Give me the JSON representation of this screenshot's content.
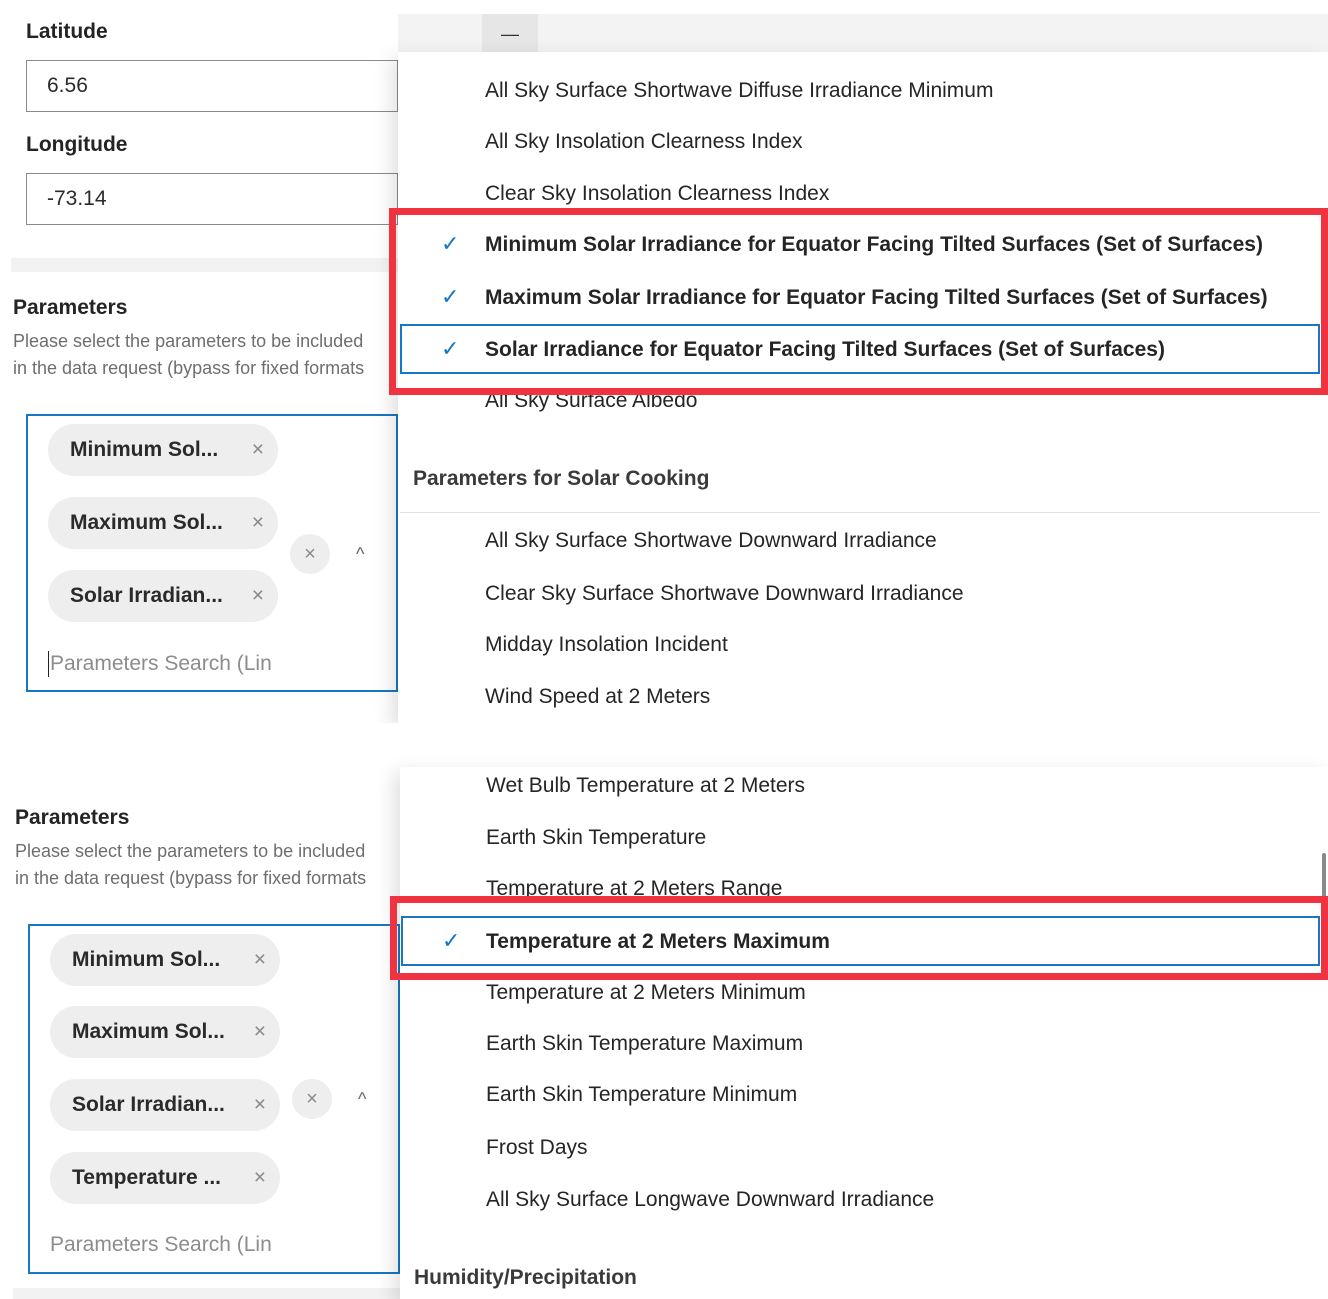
{
  "colors": {
    "accent": "#1677c4",
    "highlight": "#ef3340",
    "chip": "#eeeeee"
  },
  "top": {
    "latitude_label": "Latitude",
    "latitude_value": "6.56",
    "longitude_label": "Longitude",
    "longitude_value": "-73.14",
    "collapse_button": "—",
    "parameters_title": "Parameters",
    "parameters_desc_1": "Please select the parameters to be included",
    "parameters_desc_2": "in the data request (bypass for fixed formats",
    "chips": [
      "Minimum Sol...",
      "Maximum Sol...",
      "Solar Irradian..."
    ],
    "chip_remove": "×",
    "clear_all": "×",
    "caret": "^",
    "search_placeholder": "Parameters Search (Lin",
    "options_a": [
      "All Sky Surface Shortwave Diffuse Irradiance Minimum",
      "All Sky Insolation Clearness Index",
      "Clear Sky Insolation Clearness Index"
    ],
    "selected": [
      "Minimum Solar Irradiance for Equator Facing Tilted Surfaces (Set of Surfaces)",
      "Maximum Solar Irradiance for Equator Facing Tilted Surfaces (Set of Surfaces)",
      "Solar Irradiance for Equator Facing Tilted Surfaces (Set of Surfaces)"
    ],
    "check": "✓",
    "option_after": "All Sky Surface Albedo",
    "group_label": "Parameters for Solar Cooking",
    "options_b": [
      "All Sky Surface Shortwave Downward Irradiance",
      "Clear Sky Surface Shortwave Downward Irradiance",
      "Midday Insolation Incident",
      "Wind Speed at 2 Meters"
    ]
  },
  "bottom": {
    "parameters_title": "Parameters",
    "parameters_desc_1": "Please select the parameters to be included",
    "parameters_desc_2": "in the data request (bypass for fixed formats",
    "chips": [
      "Minimum Sol...",
      "Maximum Sol...",
      "Solar Irradian...",
      "Temperature ..."
    ],
    "chip_remove": "×",
    "clear_all": "×",
    "caret": "^",
    "search_placeholder": "Parameters Search (Lin",
    "option_cut": "Wet Bulb Temperature at 2 Meters",
    "options_a": [
      "Earth Skin Temperature",
      "Temperature at 2 Meters Range"
    ],
    "selected": "Temperature at 2 Meters Maximum",
    "check": "✓",
    "options_b": [
      "Temperature at 2 Meters Minimum",
      "Earth Skin Temperature Maximum",
      "Earth Skin Temperature Minimum",
      "Frost Days",
      "All Sky Surface Longwave Downward Irradiance"
    ],
    "group_label": "Humidity/Precipitation"
  }
}
